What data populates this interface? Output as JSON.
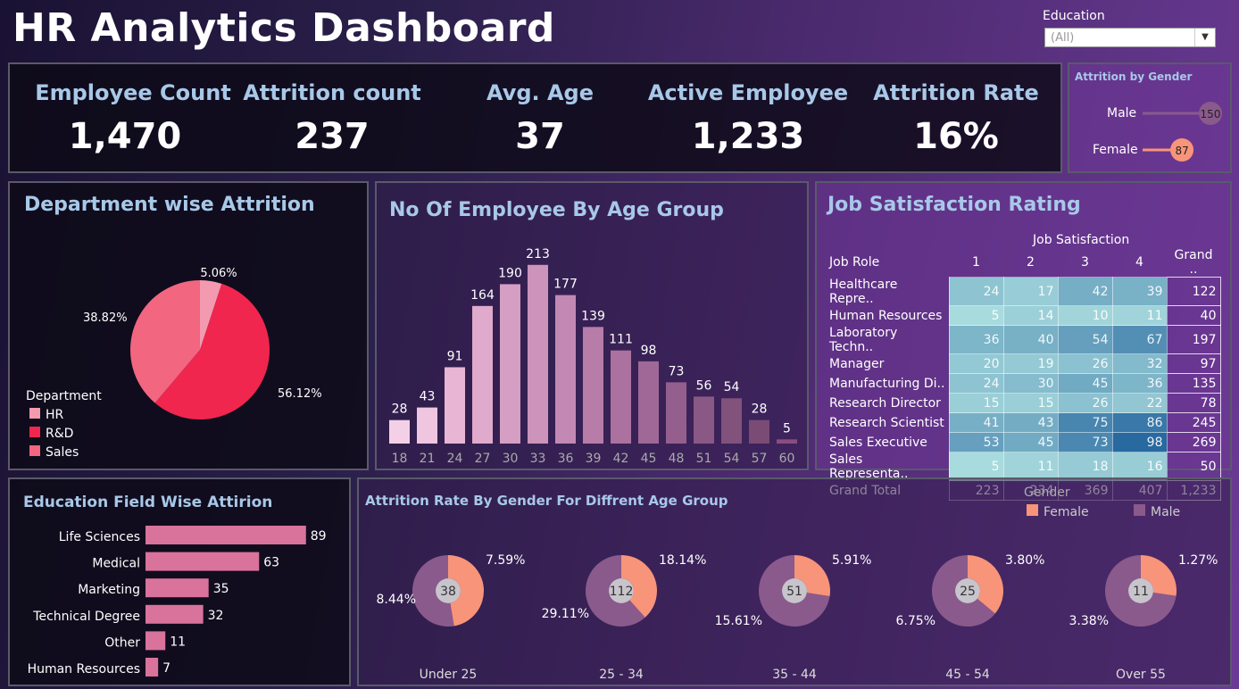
{
  "header": {
    "title": "HR Analytics Dashboard"
  },
  "filter": {
    "label": "Education",
    "value": "(All)"
  },
  "kpis": [
    {
      "label": "Employee Count",
      "value": "1,470"
    },
    {
      "label": "Attrition count",
      "value": "237"
    },
    {
      "label": "Avg. Age",
      "value": "37"
    },
    {
      "label": "Active Employee",
      "value": "1,233"
    },
    {
      "label": "Attrition Rate",
      "value": "16%"
    }
  ],
  "gender_attrition": {
    "title": "Attrition by Gender",
    "rows": [
      {
        "label": "Male",
        "value": "150"
      },
      {
        "label": "Female",
        "value": "87"
      }
    ],
    "male_value": 150,
    "female_value": 87
  },
  "dept": {
    "title": "Department wise Attrition",
    "legend_title": "Department",
    "legend": [
      "HR",
      "R&D",
      "Sales"
    ],
    "labels": [
      "5.06%",
      "56.12%",
      "38.82%"
    ],
    "colors": {
      "HR": "#f49ab0",
      "R&D": "#f0264f",
      "Sales": "#f26680"
    }
  },
  "age": {
    "title": "No Of Employee By Age Group"
  },
  "job_sat": {
    "title": "Job Satisfaction Rating",
    "col_header": "Job Satisfaction",
    "headers": [
      "Job Role",
      "1",
      "2",
      "3",
      "4",
      "Grand .."
    ],
    "rows": [
      [
        "Healthcare Repre..",
        "24",
        "17",
        "42",
        "39",
        "122"
      ],
      [
        "Human Resources",
        "5",
        "14",
        "10",
        "11",
        "40"
      ],
      [
        "Laboratory Techn..",
        "36",
        "40",
        "54",
        "67",
        "197"
      ],
      [
        "Manager",
        "20",
        "19",
        "26",
        "32",
        "97"
      ],
      [
        "Manufacturing Di..",
        "24",
        "30",
        "45",
        "36",
        "135"
      ],
      [
        "Research Director",
        "15",
        "15",
        "26",
        "22",
        "78"
      ],
      [
        "Research Scientist",
        "41",
        "43",
        "75",
        "86",
        "245"
      ],
      [
        "Sales Executive",
        "53",
        "45",
        "73",
        "98",
        "269"
      ],
      [
        "Sales Representa..",
        "5",
        "11",
        "18",
        "16",
        "50"
      ],
      [
        "Grand Total",
        "223",
        "234",
        "369",
        "407",
        "1,233"
      ]
    ]
  },
  "edu": {
    "title": "Education Field Wise Attirion"
  },
  "gender_age": {
    "title": "Attrition Rate By Gender For Diffrent Age Group",
    "legend_title": "Gender",
    "legend": [
      "Female",
      "Male"
    ],
    "colors": {
      "Female": "#f8947a",
      "Male": "#8a5a8c"
    }
  },
  "chart_data": [
    {
      "type": "pie",
      "title": "Department wise Attrition",
      "categories": [
        "HR",
        "R&D",
        "Sales"
      ],
      "values": [
        5.06,
        56.12,
        38.82
      ]
    },
    {
      "type": "bar",
      "title": "No Of Employee By Age Group",
      "categories": [
        "18",
        "21",
        "24",
        "27",
        "30",
        "33",
        "36",
        "39",
        "42",
        "45",
        "48",
        "51",
        "54",
        "57",
        "60"
      ],
      "values": [
        28,
        43,
        91,
        164,
        190,
        213,
        177,
        139,
        111,
        98,
        73,
        56,
        54,
        28,
        5
      ]
    },
    {
      "type": "bar",
      "title": "Education Field Wise Attirion",
      "categories": [
        "Life Sciences",
        "Medical",
        "Marketing",
        "Technical Degree",
        "Other",
        "Human Resources"
      ],
      "values": [
        89,
        63,
        35,
        32,
        11,
        7
      ]
    },
    {
      "type": "pie",
      "title": "Attrition Rate By Gender For Diffrent Age Group",
      "groups": [
        {
          "name": "Under 25",
          "total": 38,
          "female": "7.59%",
          "male": "8.44%",
          "female_v": 7.59,
          "male_v": 8.44
        },
        {
          "name": "25 - 34",
          "total": 112,
          "female": "18.14%",
          "male": "29.11%",
          "female_v": 18.14,
          "male_v": 29.11
        },
        {
          "name": "35 - 44",
          "total": 51,
          "female": "5.91%",
          "male": "15.61%",
          "female_v": 5.91,
          "male_v": 15.61
        },
        {
          "name": "45 - 54",
          "total": 25,
          "female": "3.80%",
          "male": "6.75%",
          "female_v": 3.8,
          "male_v": 6.75
        },
        {
          "name": "Over 55",
          "total": 11,
          "female": "1.27%",
          "male": "3.38%",
          "female_v": 1.27,
          "male_v": 3.38
        }
      ]
    }
  ]
}
